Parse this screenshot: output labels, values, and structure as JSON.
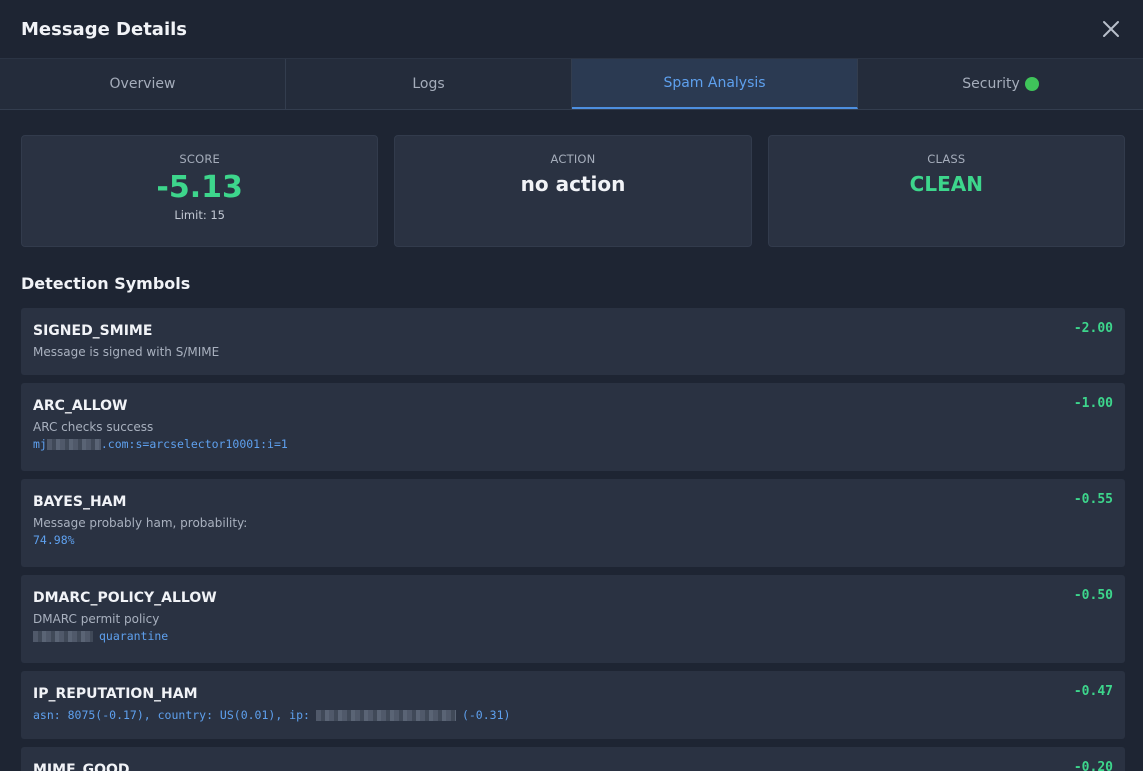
{
  "header": {
    "title": "Message Details"
  },
  "tabs": [
    {
      "label": "Overview",
      "active": false
    },
    {
      "label": "Logs",
      "active": false
    },
    {
      "label": "Spam Analysis",
      "active": true
    },
    {
      "label": "Security",
      "active": false,
      "status_icon": "green-circle-icon"
    }
  ],
  "summary": {
    "score": {
      "label": "SCORE",
      "value": "-5.13",
      "limit": "Limit: 15"
    },
    "action": {
      "label": "ACTION",
      "value": "no action"
    },
    "class": {
      "label": "CLASS",
      "value": "CLEAN"
    }
  },
  "colors": {
    "accent": "#4d8fe0",
    "positive": "#3dd68c",
    "background": "#1e2533",
    "card": "#2a3242"
  },
  "symbols_title": "Detection Symbols",
  "symbols": [
    {
      "name": "SIGNED_SMIME",
      "description": "Message is signed with S/MIME",
      "option_prefix": "",
      "option_suffix": "",
      "score": "-2.00"
    },
    {
      "name": "ARC_ALLOW",
      "description": "ARC checks success",
      "option_prefix": "mj",
      "option_suffix": ".com:s=arcselector10001:i=1",
      "score": "-1.00"
    },
    {
      "name": "BAYES_HAM",
      "description": "Message probably ham, probability:",
      "option_prefix": "74.98%",
      "option_suffix": "",
      "score": "-0.55"
    },
    {
      "name": "DMARC_POLICY_ALLOW",
      "description": "DMARC permit policy",
      "option_prefix": "",
      "option_suffix": "quarantine",
      "score": "-0.50"
    },
    {
      "name": "IP_REPUTATION_HAM",
      "description": "",
      "option_prefix": "asn: 8075(-0.17), country: US(0.01), ip:",
      "option_suffix": "(-0.31)",
      "score": "-0.47"
    },
    {
      "name": "MIME_GOOD",
      "description": "",
      "option_prefix": "",
      "option_suffix": "",
      "score": "-0.20"
    }
  ]
}
